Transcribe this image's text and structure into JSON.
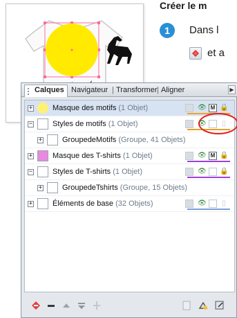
{
  "tutorial": {
    "heading": "Créer le m",
    "step_number": "1",
    "step_text": "Dans l",
    "step_text2": "et a"
  },
  "panel": {
    "tabs": [
      "Calques",
      "Navigateur",
      "Transformer",
      "Aligner"
    ],
    "more_icon": "chevron-right-icon",
    "layers": [
      {
        "name": "Masque des motifs",
        "count": "(1 Objet)",
        "expander": "+",
        "indent": 0,
        "selected": true,
        "thumb_color": "#fff176",
        "color_bar": "#f0a030"
      },
      {
        "name": "Styles de motifs",
        "count": "(1 Objet)",
        "expander": "−",
        "indent": 0,
        "selected": false,
        "thumb_color": "#ffffff",
        "color_bar": "#e8a020"
      },
      {
        "name": "GroupedeMotifs",
        "count": "(Groupe, 41 Objets)",
        "expander": "+",
        "indent": 1,
        "selected": false,
        "thumb_color": "#ffffff",
        "color_bar": ""
      },
      {
        "name": "Masque des T-shirts",
        "count": "(1 Objet)",
        "expander": "+",
        "indent": 0,
        "selected": false,
        "thumb_color": "#e88ae0",
        "color_bar": "#9a40d8"
      },
      {
        "name": "Styles de T-shirts",
        "count": "(1 Objet)",
        "expander": "−",
        "indent": 0,
        "selected": false,
        "thumb_color": "#ffffff",
        "color_bar": "#a040d8"
      },
      {
        "name": "GroupedeTshirts",
        "count": "(Groupe, 15 Objets)",
        "expander": "+",
        "indent": 1,
        "selected": false,
        "thumb_color": "#ffffff",
        "color_bar": ""
      },
      {
        "name": "Éléments de base",
        "count": "(32 Objets)",
        "expander": "+",
        "indent": 0,
        "selected": false,
        "thumb_color": "#ffffff",
        "color_bar": "#7aa0d8"
      }
    ],
    "toolbar_icons": [
      "add-layer-icon",
      "delete-layer-icon",
      "move-up-icon",
      "move-down-icon",
      "merge-icon",
      "page-icon",
      "layer-options-icon",
      "panel-settings-icon"
    ]
  }
}
